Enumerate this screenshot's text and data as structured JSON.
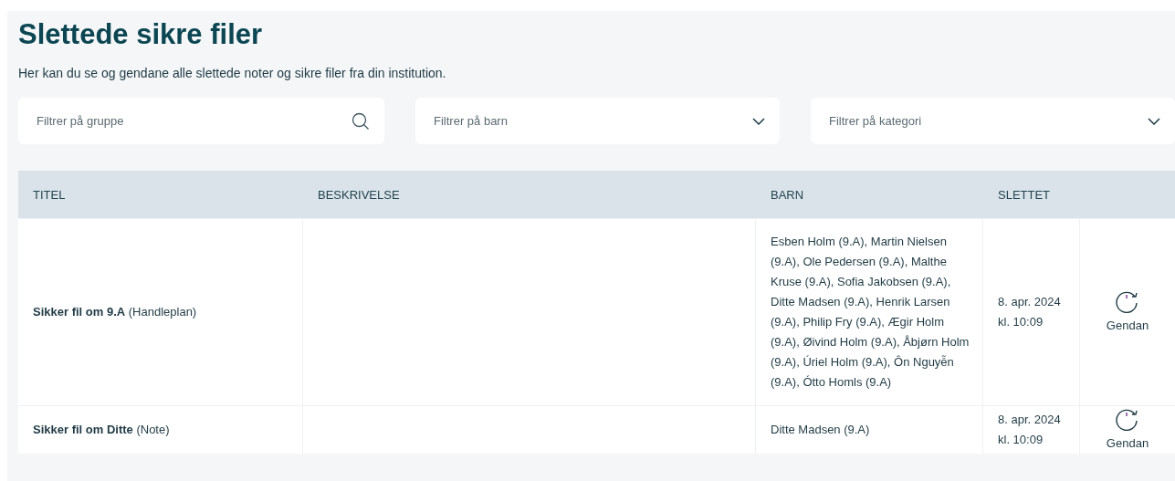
{
  "title": "Slettede sikre filer",
  "description": "Her kan du se og gendane alle slettede noter og sikre filer fra din institution.",
  "filters": [
    {
      "kind": "search",
      "placeholder": "Filtrer på gruppe"
    },
    {
      "kind": "dropdown",
      "placeholder": "Filtrer på barn"
    },
    {
      "kind": "dropdown",
      "placeholder": "Filtrer på kategori"
    }
  ],
  "table": {
    "columns": [
      "TITEL",
      "BESKRIVELSE",
      "BARN",
      "SLETTET"
    ],
    "rows": [
      {
        "title": "**Sikker fil om 9.A** (Handleplan)",
        "children": "Esben Holm (9.A), Martin Nielsen (9.A), Ole Pedersen (9.A), Malthe Kruse (9.A), Sofia Jakobsen (9.A), Ditte Madsen (9.A), Henrik Larsen (9.A), Philip Fry (9.A), Ægir Holm (9.A), Øivind Holm (9.A), Åbjørn Holm (9.A), Úriel Holm (9.A), Ôn Nguyễn (9.A), Ótto Homls (9.A)",
        "deleted_date": "8. apr. 2024",
        "deleted_time": "kl. 10:09",
        "action": "Gendan"
      },
      {
        "title": "**Sikker fil om Ditte** (Note)",
        "children": "Ditte Madsen (9.A)",
        "deleted_date": "8. apr. 2024",
        "deleted_time": "kl. 10:09",
        "action": "Gendan"
      }
    ]
  }
}
